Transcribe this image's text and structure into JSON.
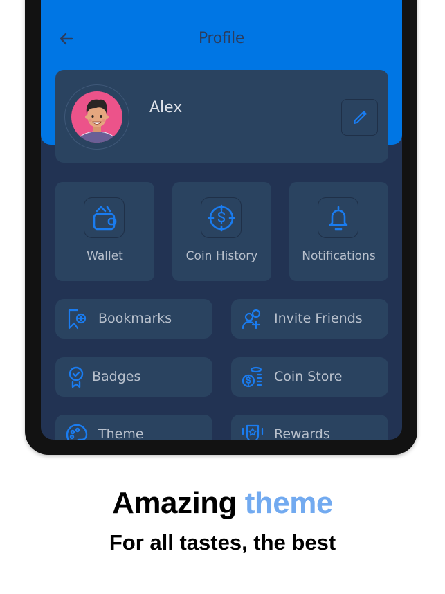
{
  "header": {
    "title": "Profile",
    "back_icon": "arrow-left-icon"
  },
  "profile": {
    "name": "Alex",
    "avatar": "avatar-illustration",
    "edit_icon": "pencil-icon"
  },
  "tiles": [
    {
      "label": "Wallet",
      "icon": "wallet-icon"
    },
    {
      "label": "Coin History",
      "icon": "coin-history-icon"
    },
    {
      "label": "Notifications",
      "icon": "bell-icon"
    }
  ],
  "menu": [
    {
      "label": "Bookmarks",
      "icon": "bookmark-add-icon"
    },
    {
      "label": "Invite Friends",
      "icon": "invite-friends-icon"
    },
    {
      "label": "Badges",
      "icon": "badge-icon"
    },
    {
      "label": "Coin Store",
      "icon": "coin-stack-icon"
    },
    {
      "label": "Theme",
      "icon": "palette-icon"
    },
    {
      "label": "Rewards",
      "icon": "reward-shield-icon"
    }
  ],
  "caption": {
    "main": "Amazing",
    "accent": "theme",
    "sub": "For all tastes, the best"
  },
  "colors": {
    "header_blue": "#0076e4",
    "background": "#223353",
    "card": "#2a4360",
    "icon_blue": "#1a7cf0",
    "caption_accent": "#72aaf0"
  }
}
